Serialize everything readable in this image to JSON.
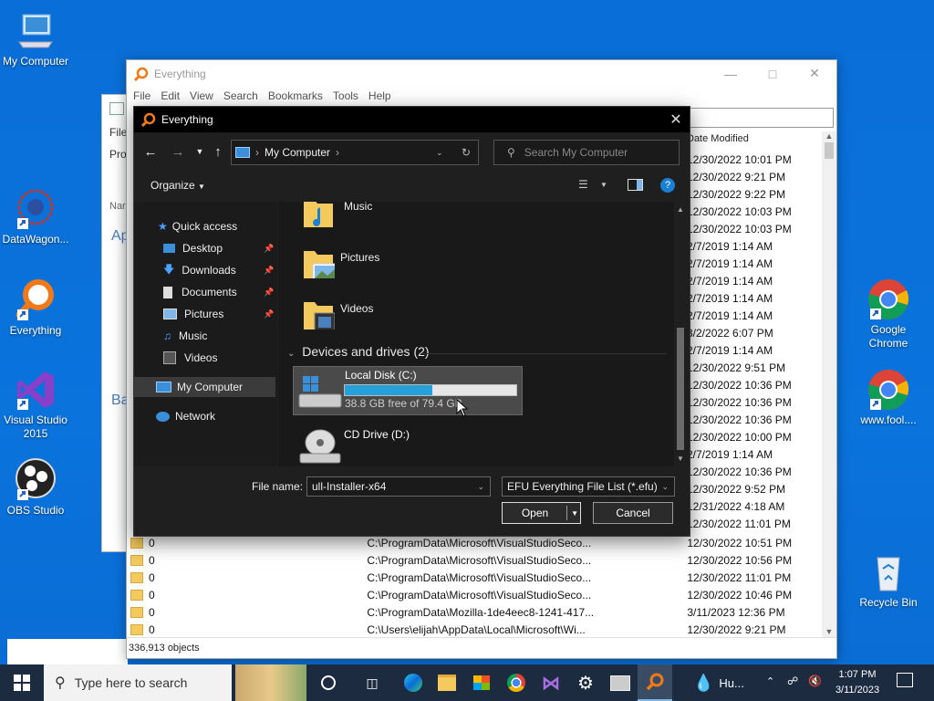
{
  "desktop": {
    "icons_left": [
      {
        "label": "My Computer"
      },
      {
        "label": "DataWagon..."
      },
      {
        "label": "Everything"
      },
      {
        "label": "Visual Studio 2015"
      },
      {
        "label": "OBS Studio"
      }
    ],
    "icons_right": [
      {
        "label": "Google Chrome"
      },
      {
        "label": "www.fool...."
      },
      {
        "label": "Recycle Bin"
      }
    ]
  },
  "main_window": {
    "title": "Everything",
    "menu": [
      "File",
      "Edit",
      "View",
      "Search",
      "Bookmarks",
      "Tools",
      "Help"
    ],
    "column_date": "Date Modified",
    "dates": [
      "12/30/2022 10:01 PM",
      "12/30/2022 9:21 PM",
      "12/30/2022 9:22 PM",
      "12/30/2022 10:03 PM",
      "12/30/2022 10:03 PM",
      "2/7/2019 1:14 AM",
      "2/7/2019 1:14 AM",
      "2/7/2019 1:14 AM",
      "2/7/2019 1:14 AM",
      "2/7/2019 1:14 AM",
      "3/2/2022 6:07 PM",
      "2/7/2019 1:14 AM",
      "12/30/2022 9:51 PM",
      "12/30/2022 10:36 PM",
      "12/30/2022 10:36 PM",
      "12/30/2022 10:36 PM",
      "12/30/2022 10:00 PM",
      "2/7/2019 1:14 AM",
      "12/30/2022 10:36 PM",
      "12/30/2022 9:52 PM",
      "12/31/2022 4:18 AM",
      "12/30/2022 11:01 PM"
    ],
    "rows": [
      {
        "name": "0",
        "path": "C:\\ProgramData\\Microsoft\\VisualStudioSeco...",
        "date": "12/30/2022 10:51 PM"
      },
      {
        "name": "0",
        "path": "C:\\ProgramData\\Microsoft\\VisualStudioSeco...",
        "date": "12/30/2022 10:56 PM"
      },
      {
        "name": "0",
        "path": "C:\\ProgramData\\Microsoft\\VisualStudioSeco...",
        "date": "12/30/2022 11:01 PM"
      },
      {
        "name": "0",
        "path": "C:\\ProgramData\\Microsoft\\VisualStudioSeco...",
        "date": "12/30/2022 10:46 PM"
      },
      {
        "name": "0",
        "path": "C:\\ProgramData\\Mozilla-1de4eec8-1241-417...",
        "date": "3/11/2023 12:36 PM"
      },
      {
        "name": "0",
        "path": "C:\\Users\\elijah\\AppData\\Local\\Microsoft\\Wi...",
        "date": "12/30/2022 9:21 PM"
      }
    ],
    "status": "336,913 objects"
  },
  "background_window": {
    "file_label": "File",
    "pro_label": "Pro",
    "nar_label": "Nar",
    "ap_label": "Ap",
    "ba_label": "Ba"
  },
  "dialog": {
    "title": "Everything",
    "breadcrumb": "My Computer",
    "search_placeholder": "Search My Computer",
    "organize": "Organize",
    "nav": {
      "quick_access": "Quick access",
      "desktop": "Desktop",
      "downloads": "Downloads",
      "documents": "Documents",
      "pictures": "Pictures",
      "music": "Music",
      "videos": "Videos",
      "my_computer": "My Computer",
      "network": "Network"
    },
    "folders": {
      "music": "Music",
      "pictures": "Pictures",
      "videos": "Videos"
    },
    "drives_header": "Devices and drives (2)",
    "drive_c": {
      "name": "Local Disk (C:)",
      "free_text": "38.8 GB free of 79.4 GB",
      "used_fraction": 0.51
    },
    "drive_d": {
      "name": "CD Drive (D:)"
    },
    "file_name_label": "File name:",
    "file_name_value": "ull-Installer-x64",
    "file_type": "EFU Everything File List (*.efu)",
    "open": "Open",
    "cancel": "Cancel"
  },
  "taskbar": {
    "search_placeholder": "Type here to search",
    "app_label": "Hu...",
    "time": "1:07 PM",
    "date": "3/11/2023"
  },
  "colors": {
    "accent": "#1a80d4",
    "drive_bar": "#26a0da",
    "desktop": "#0a6ed8"
  }
}
